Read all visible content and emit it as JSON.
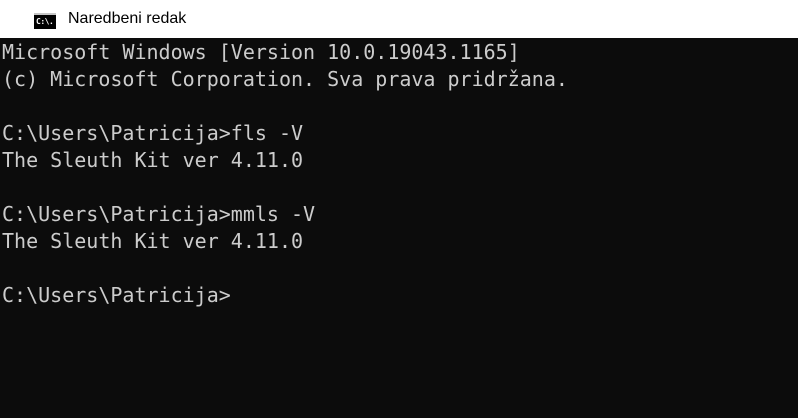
{
  "window": {
    "title": "Naredbeni redak",
    "icon_text": "C:\\."
  },
  "console": {
    "lines": [
      "Microsoft Windows [Version 10.0.19043.1165]",
      "(c) Microsoft Corporation. Sva prava pridržana.",
      "",
      "C:\\Users\\Patricija>fls -V",
      "The Sleuth Kit ver 4.11.0",
      "",
      "C:\\Users\\Patricija>mmls -V",
      "The Sleuth Kit ver 4.11.0",
      "",
      "C:\\Users\\Patricija>"
    ]
  },
  "colors": {
    "background": "#0c0c0c",
    "text": "#cccccc",
    "titlebar": "#ffffff"
  }
}
